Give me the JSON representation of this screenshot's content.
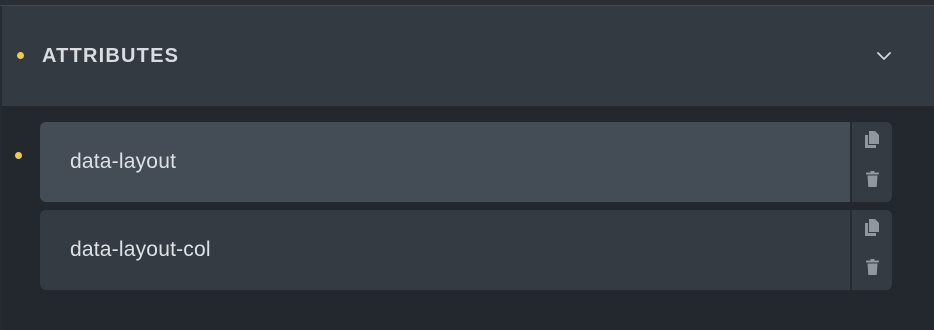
{
  "colors": {
    "accent_dot": "#f2c94c",
    "icon": "#8f979f",
    "active_row": "#444d56",
    "inactive_row": "#353b42"
  },
  "panel": {
    "title": "ATTRIBUTES",
    "header_marker_icon": "dot-indicator",
    "collapse_icon": "chevron-down-icon"
  },
  "attributes": [
    {
      "name": "data-layout",
      "active": true,
      "marked": true,
      "copy_icon": "copy-icon",
      "delete_icon": "trash-icon"
    },
    {
      "name": "data-layout-col",
      "active": false,
      "marked": false,
      "copy_icon": "copy-icon",
      "delete_icon": "trash-icon"
    }
  ]
}
